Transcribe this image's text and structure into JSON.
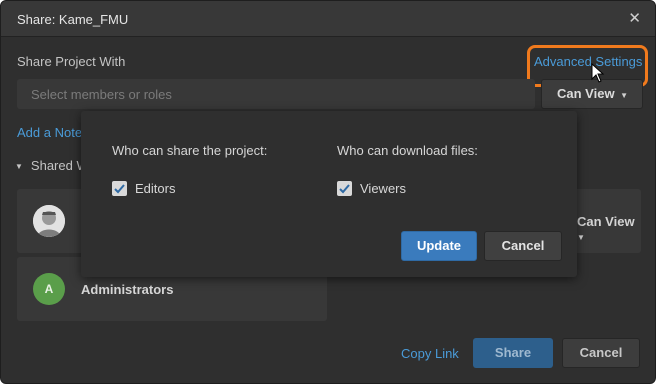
{
  "dialog": {
    "title": "Share: Kame_FMU",
    "close_icon": "close-icon"
  },
  "share": {
    "label": "Share Project With",
    "advanced_settings": "Advanced Settings",
    "search_placeholder": "Select members or roles",
    "permission_value": "Can View"
  },
  "note": {
    "add_note": "Add a Note"
  },
  "shared_section": {
    "label": "Shared With"
  },
  "members": [
    {
      "avatar": "user-photo-avatar",
      "role": "Can View"
    },
    {
      "initial": "A",
      "name": "Administrators",
      "avatar_color": "#5a9e4a"
    }
  ],
  "footer": {
    "copy_link": "Copy Link",
    "share": "Share",
    "cancel": "Cancel"
  },
  "advanced_popover": {
    "share_heading": "Who can share the project:",
    "download_heading": "Who can download files:",
    "editors_label": "Editors",
    "editors_checked": true,
    "viewers_label": "Viewers",
    "viewers_checked": true,
    "update": "Update",
    "cancel": "Cancel"
  },
  "colors": {
    "accent": "#4a9bd8",
    "highlight": "#f07a1d",
    "update_button": "#3a7bbd"
  }
}
